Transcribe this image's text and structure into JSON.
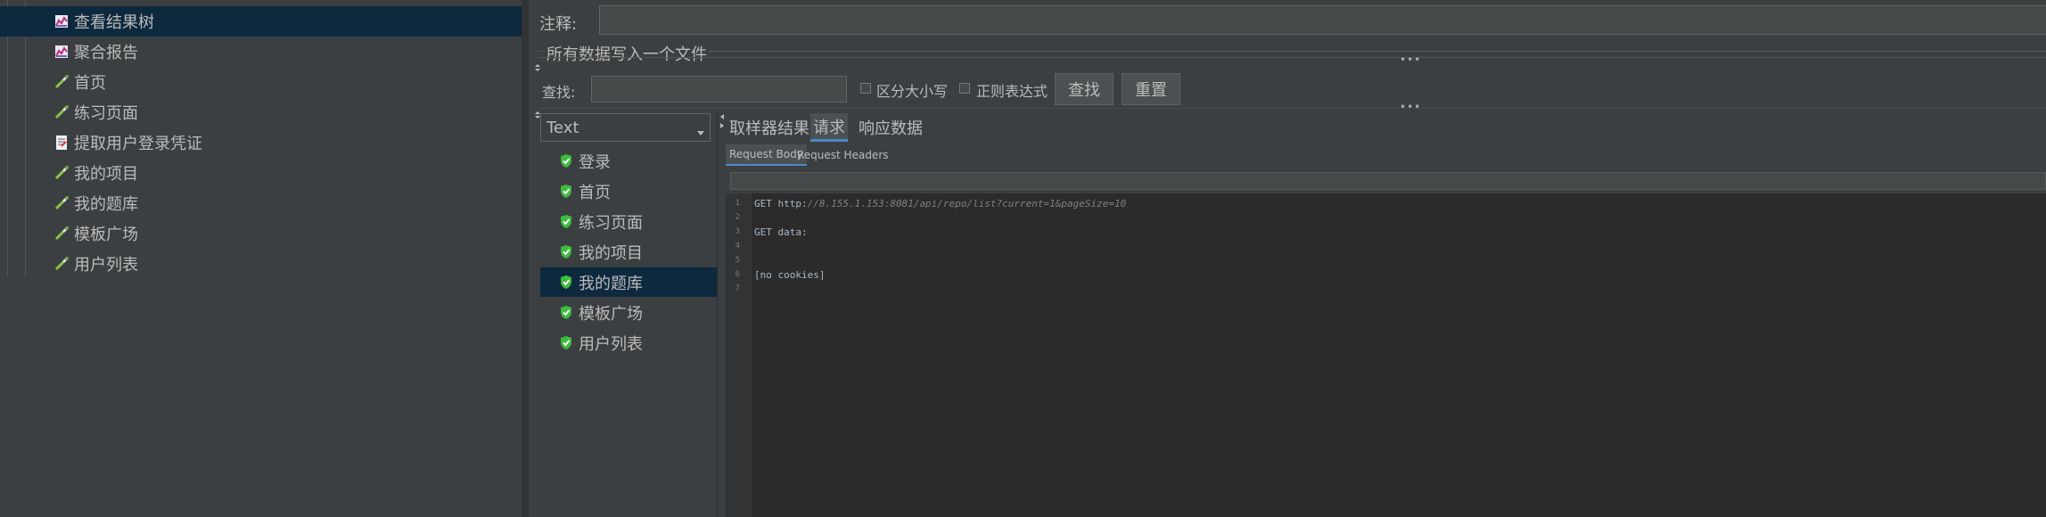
{
  "tree": {
    "items": [
      {
        "label": "查看结果树",
        "icon": "graph-listener-icon",
        "selected": true
      },
      {
        "label": "聚合报告",
        "icon": "graph-listener-icon",
        "selected": false
      },
      {
        "label": "首页",
        "icon": "pipette-sampler-icon",
        "selected": false
      },
      {
        "label": "练习页面",
        "icon": "pipette-sampler-icon",
        "selected": false
      },
      {
        "label": "提取用户登录凭证",
        "icon": "document-extractor-icon",
        "selected": false
      },
      {
        "label": "我的项目",
        "icon": "pipette-sampler-icon",
        "selected": false
      },
      {
        "label": "我的题库",
        "icon": "pipette-sampler-icon",
        "selected": false
      },
      {
        "label": "模板广场",
        "icon": "pipette-sampler-icon",
        "selected": false
      },
      {
        "label": "用户列表",
        "icon": "pipette-sampler-icon",
        "selected": false
      }
    ]
  },
  "comment": {
    "label": "注释:",
    "value": ""
  },
  "write_all": {
    "label": "所有数据写入一个文件"
  },
  "search": {
    "label": "查找:",
    "value": "",
    "case_sensitive_label": "区分大小写",
    "regex_label": "正则表达式",
    "find_button": "查找",
    "reset_button": "重置"
  },
  "renderer": {
    "selected": "Text"
  },
  "results": {
    "items": [
      {
        "label": "登录",
        "selected": false
      },
      {
        "label": "首页",
        "selected": false
      },
      {
        "label": "练习页面",
        "selected": false
      },
      {
        "label": "我的项目",
        "selected": false
      },
      {
        "label": "我的题库",
        "selected": true
      },
      {
        "label": "模板广场",
        "selected": false
      },
      {
        "label": "用户列表",
        "selected": false
      }
    ]
  },
  "tabs": {
    "sampler_result": "取样器结果",
    "request": "请求",
    "response_data": "响应数据"
  },
  "subtabs": {
    "request_body": "Request Body",
    "request_headers": "Request Headers"
  },
  "editor": {
    "lines": [
      {
        "num": "1",
        "prefix": "GET http:",
        "url": "//8.155.1.153:8081/api/repo/list?current=1&pageSize=10"
      },
      {
        "num": "2",
        "prefix": "",
        "url": ""
      },
      {
        "num": "3",
        "prefix": "GET data:",
        "url": ""
      },
      {
        "num": "4",
        "prefix": "",
        "url": ""
      },
      {
        "num": "5",
        "prefix": "",
        "url": ""
      },
      {
        "num": "6",
        "prefix": "[no cookies]",
        "url": ""
      },
      {
        "num": "7",
        "prefix": "",
        "url": ""
      }
    ]
  },
  "colors": {
    "background": "#3c3f41",
    "selection": "#0d293e",
    "accent": "#4a88c7",
    "success": "#3dbb3d"
  }
}
